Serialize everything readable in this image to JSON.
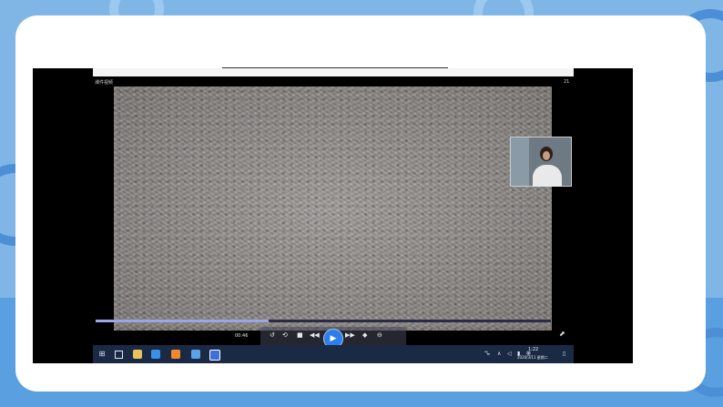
{
  "slide": {
    "video": {
      "window_title": "课件视频",
      "window_corner": "21",
      "elapsed_time": "00:46",
      "progress_fraction": 0.38,
      "controls": {
        "back_icon": "↺",
        "loop_icon": "⟲",
        "stop_icon": "■",
        "prev_icon": "◀◀",
        "play_icon": "▶",
        "next_icon": "▶▶",
        "volume_icon": "◆",
        "settings_icon": "⊖",
        "expand_icon": "⬈"
      }
    },
    "taskbar": {
      "start_icon": "⊞",
      "tray": {
        "network_label": "ꘛ",
        "chevron_label": "∧",
        "speaker_label": "◁",
        "battery_label": "▮",
        "ime_label": "英",
        "notify_label": "▯"
      },
      "clock_time": "1:22",
      "clock_date": "2020/3/11 星期二"
    }
  },
  "colors": {
    "background": "#7fb6e6",
    "taskbar": "#1b2a44",
    "play_button": "#2d7ee8",
    "progress": "#9aa6e8"
  }
}
